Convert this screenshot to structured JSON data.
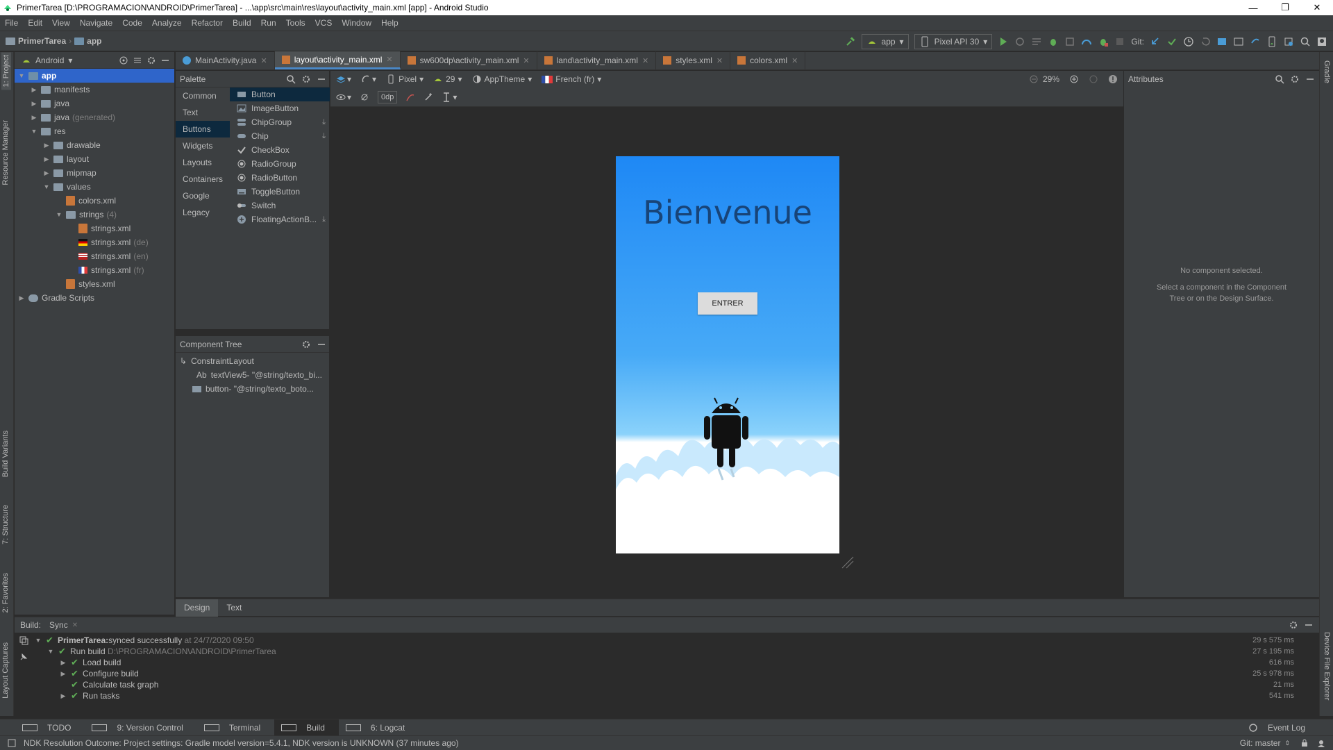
{
  "window": {
    "title": "PrimerTarea [D:\\PROGRAMACION\\ANDROID\\PrimerTarea] - ...\\app\\src\\main\\res\\layout\\activity_main.xml [app] - Android Studio"
  },
  "menu": [
    "File",
    "Edit",
    "View",
    "Navigate",
    "Code",
    "Analyze",
    "Refactor",
    "Build",
    "Run",
    "Tools",
    "VCS",
    "Window",
    "Help"
  ],
  "breadcrumb": {
    "project": "PrimerTarea",
    "module": "app"
  },
  "run_config": {
    "module": "app",
    "device": "Pixel API 30",
    "git_label": "Git:"
  },
  "project_panel": {
    "view_mode": "Android"
  },
  "tree": [
    {
      "label": "app",
      "indent": 0,
      "arrow": "▼",
      "kind": "module",
      "selected": true
    },
    {
      "label": "manifests",
      "indent": 1,
      "arrow": "▶",
      "kind": "folder"
    },
    {
      "label": "java",
      "indent": 1,
      "arrow": "▶",
      "kind": "folder"
    },
    {
      "label": "java",
      "suffix": "(generated)",
      "indent": 1,
      "arrow": "▶",
      "kind": "folder"
    },
    {
      "label": "res",
      "indent": 1,
      "arrow": "▼",
      "kind": "folder"
    },
    {
      "label": "drawable",
      "indent": 2,
      "arrow": "▶",
      "kind": "folder"
    },
    {
      "label": "layout",
      "indent": 2,
      "arrow": "▶",
      "kind": "folder"
    },
    {
      "label": "mipmap",
      "indent": 2,
      "arrow": "▶",
      "kind": "folder"
    },
    {
      "label": "values",
      "indent": 2,
      "arrow": "▼",
      "kind": "folder"
    },
    {
      "label": "colors.xml",
      "indent": 3,
      "arrow": "",
      "kind": "xml"
    },
    {
      "label": "strings",
      "suffix": "(4)",
      "indent": 3,
      "arrow": "▼",
      "kind": "folder"
    },
    {
      "label": "strings.xml",
      "indent": 4,
      "arrow": "",
      "kind": "xml"
    },
    {
      "label": "strings.xml",
      "suffix": "(de)",
      "indent": 4,
      "arrow": "",
      "kind": "flag-de"
    },
    {
      "label": "strings.xml",
      "suffix": "(en)",
      "indent": 4,
      "arrow": "",
      "kind": "flag-en"
    },
    {
      "label": "strings.xml",
      "suffix": "(fr)",
      "indent": 4,
      "arrow": "",
      "kind": "flag-fr"
    },
    {
      "label": "styles.xml",
      "indent": 3,
      "arrow": "",
      "kind": "xml"
    },
    {
      "label": "Gradle Scripts",
      "indent": 0,
      "arrow": "▶",
      "kind": "gradle"
    }
  ],
  "editor_tabs": [
    {
      "label": "MainActivity.java",
      "active": false,
      "kind": "java"
    },
    {
      "label": "layout\\activity_main.xml",
      "active": true,
      "kind": "xml"
    },
    {
      "label": "sw600dp\\activity_main.xml",
      "active": false,
      "kind": "xml"
    },
    {
      "label": "land\\activity_main.xml",
      "active": false,
      "kind": "xml"
    },
    {
      "label": "styles.xml",
      "active": false,
      "kind": "xml"
    },
    {
      "label": "colors.xml",
      "active": false,
      "kind": "xml"
    }
  ],
  "palette": {
    "title": "Palette",
    "categories": [
      {
        "label": "Common"
      },
      {
        "label": "Text"
      },
      {
        "label": "Buttons",
        "selected": true
      },
      {
        "label": "Widgets"
      },
      {
        "label": "Layouts"
      },
      {
        "label": "Containers"
      },
      {
        "label": "Google"
      },
      {
        "label": "Legacy"
      }
    ],
    "items": [
      {
        "label": "Button",
        "icon": "button-icon",
        "selected": true
      },
      {
        "label": "ImageButton",
        "icon": "imagebutton-icon"
      },
      {
        "label": "ChipGroup",
        "icon": "chipgroup-icon",
        "download": true
      },
      {
        "label": "Chip",
        "icon": "chip-icon",
        "download": true
      },
      {
        "label": "CheckBox",
        "icon": "checkbox-icon"
      },
      {
        "label": "RadioGroup",
        "icon": "radiogroup-icon"
      },
      {
        "label": "RadioButton",
        "icon": "radiobutton-icon"
      },
      {
        "label": "ToggleButton",
        "icon": "togglebutton-icon"
      },
      {
        "label": "Switch",
        "icon": "switch-icon"
      },
      {
        "label": "FloatingActionB...",
        "icon": "fab-icon",
        "download": true
      }
    ]
  },
  "design_toolbar": {
    "device": "Pixel",
    "api": "29",
    "theme": "AppTheme",
    "locale": "French (fr)",
    "zoom": "29%",
    "margin": "0dp"
  },
  "component_tree": {
    "title": "Component Tree",
    "rows": [
      {
        "label": "ConstraintLayout",
        "indent": 0,
        "icon": "constraintlayout-icon"
      },
      {
        "label": "textView5- \"@string/texto_bi...",
        "prefix": "Ab",
        "indent": 1,
        "icon": "textview-icon"
      },
      {
        "label": "button- \"@string/texto_boto...",
        "indent": 1,
        "icon": "button-icon"
      }
    ]
  },
  "preview": {
    "welcome_text": "Bienvenue",
    "button_text": "ENTRER"
  },
  "design_tabs": [
    "Design",
    "Text"
  ],
  "attributes": {
    "title": "Attributes",
    "empty_title": "No component selected.",
    "empty_hint": "Select a component in the Component Tree or on the Design Surface."
  },
  "build": {
    "label": "Build:",
    "tab": "Sync",
    "rows": [
      {
        "indent": 0,
        "arrow": "▼",
        "text": "PrimerTarea:",
        "bold": true,
        "rest": " synced successfully",
        "dim": " at 24/7/2020 09:50",
        "time": "29 s 575 ms"
      },
      {
        "indent": 1,
        "arrow": "▼",
        "text": "Run build",
        "dim": " D:\\PROGRAMACION\\ANDROID\\PrimerTarea",
        "time": "27 s 195 ms"
      },
      {
        "indent": 2,
        "arrow": "▶",
        "text": "Load build",
        "time": "616 ms"
      },
      {
        "indent": 2,
        "arrow": "▶",
        "text": "Configure build",
        "time": "25 s 978 ms"
      },
      {
        "indent": 2,
        "arrow": "",
        "text": "Calculate task graph",
        "time": "21 ms"
      },
      {
        "indent": 2,
        "arrow": "▶",
        "text": "Run tasks",
        "time": "541 ms"
      }
    ]
  },
  "bottom_tools": [
    {
      "label": "TODO",
      "icon": "list-icon"
    },
    {
      "label": "9: Version Control",
      "icon": "vcs-icon"
    },
    {
      "label": "Terminal",
      "icon": "terminal-icon"
    },
    {
      "label": "Build",
      "icon": "hammer-icon",
      "selected": true
    },
    {
      "label": "6: Logcat",
      "icon": "logcat-icon"
    }
  ],
  "event_log": "Event Log",
  "status": {
    "message": "NDK Resolution Outcome: Project settings: Gradle model version=5.4.1, NDK version is UNKNOWN (37 minutes ago)",
    "branch": "Git: master"
  },
  "side_tabs": {
    "left": [
      "1: Project",
      "Resource Manager",
      "Build Variants",
      "7: Structure",
      "2: Favorites",
      "Layout Captures"
    ],
    "right": [
      "Gradle",
      "Device File Explorer"
    ]
  }
}
